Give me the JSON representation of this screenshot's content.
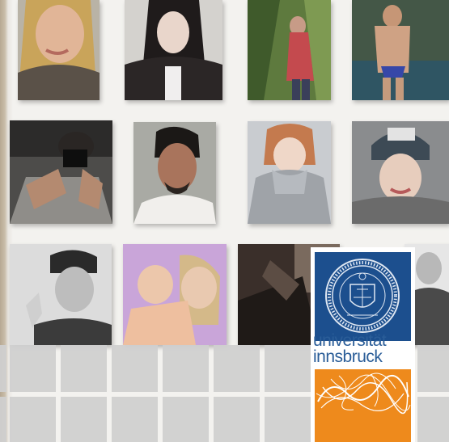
{
  "logo": {
    "line1": "universität",
    "line2": "innsbruck",
    "colors": {
      "seal": "#1c4f8e",
      "text": "#2a5d98",
      "accent": "#ee8a1c"
    }
  },
  "photos": [
    {
      "subject": "woman-blonde-hair-selfie"
    },
    {
      "subject": "woman-dark-hair-selfie"
    },
    {
      "subject": "woman-in-forest"
    },
    {
      "subject": "man-shirtless-by-pool"
    },
    {
      "subject": "man-with-camera-selfie"
    },
    {
      "subject": "man-dark-hair-portrait"
    },
    {
      "subject": "woman-grey-hoodie"
    },
    {
      "subject": "woman-knit-beanie"
    },
    {
      "subject": "person-bandana-peace-sign"
    },
    {
      "subject": "woman-with-child"
    },
    {
      "subject": "dark-interior-scene"
    },
    {
      "subject": "couple-black-and-white"
    }
  ]
}
